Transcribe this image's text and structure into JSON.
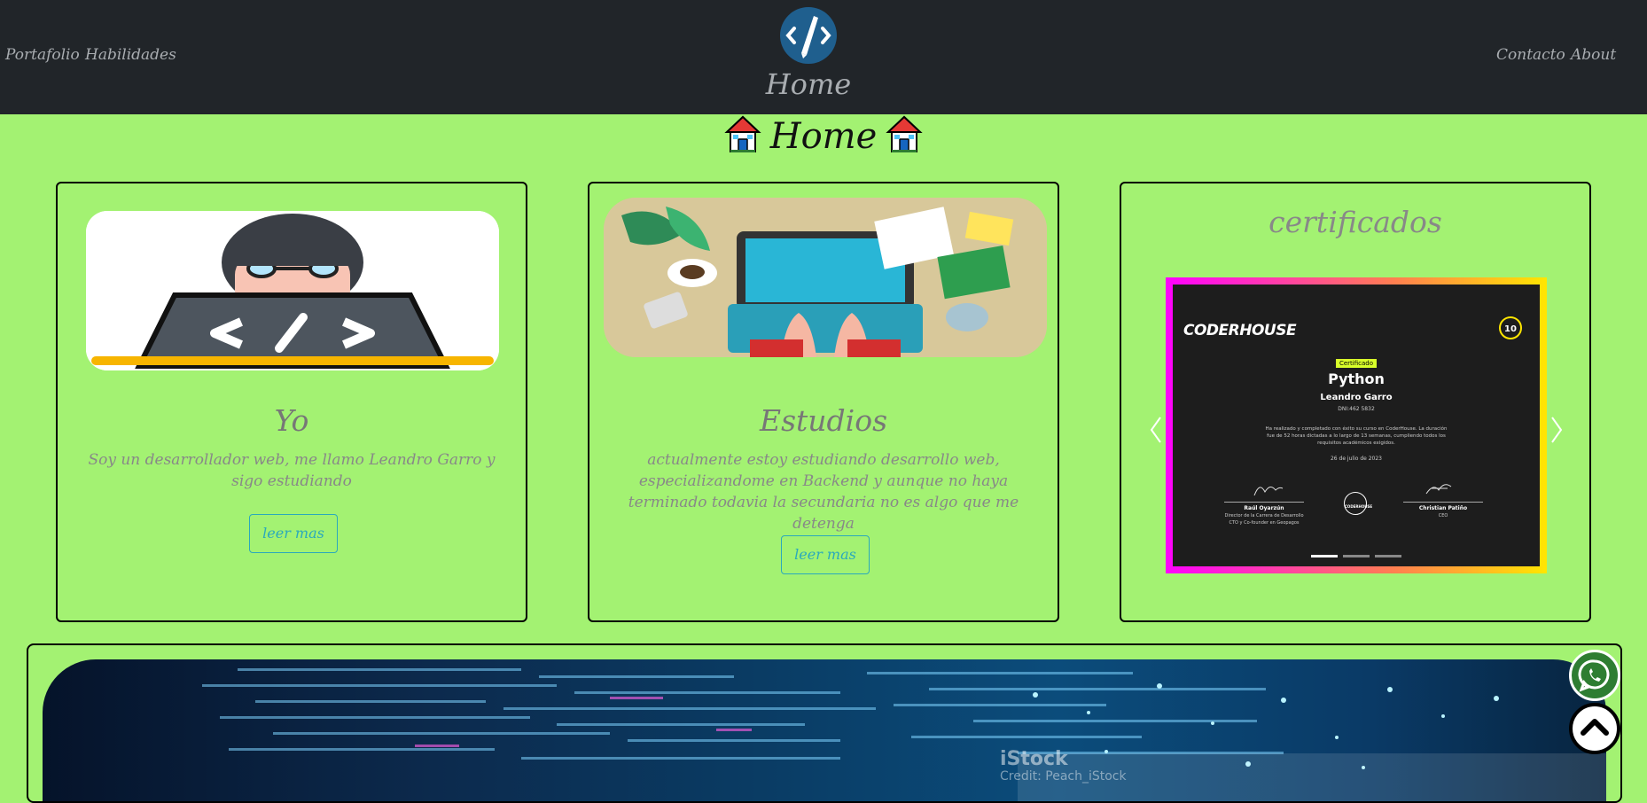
{
  "nav": {
    "left_links": [
      "Portafolio",
      "Habilidades"
    ],
    "right_links": [
      "Contacto",
      "About"
    ],
    "brand": "Home"
  },
  "page": {
    "title": "Home"
  },
  "cards": {
    "yo": {
      "title": "Yo",
      "text": "Soy un desarrollador web, me llamo Leandro Garro y sigo estudiando",
      "button": "leer mas"
    },
    "estudios": {
      "title": "Estudios",
      "text": "actualmente estoy estudiando desarrollo web, especializandome en Backend y aunque no haya terminado todavia la secundaria no es algo que me detenga",
      "button": "leer mas"
    },
    "certificados": {
      "title": "certificados",
      "carousel": {
        "slide_count": 3,
        "active_index": 0,
        "slide": {
          "brand": "CODERHOUSE",
          "badge": "Certificado",
          "course": "Python",
          "student": "Leandro Garro",
          "dni": "DNI:462 5832",
          "body": "Ha realizado y completado con éxito su curso en CoderHouse. La duración fue de 52 horas dictadas a lo largo de 13 semanas, cumpliendo todos los requisitos académicos exigidos.",
          "date": "26 de julio de 2023",
          "signer_left_name": "Raúl Oyarzún",
          "signer_left_role": "Director de la Carrera de Desarrollo",
          "signer_left_role2": "CTO y Co-founder en Geopagos",
          "center_seal": "CODERHOUSE",
          "signer_right_name": "Christian Patiño",
          "signer_right_role": "CEO",
          "top_badge": "10"
        }
      }
    }
  },
  "banner": {
    "watermark": "iStock",
    "credit": "Credit: Peach_iStock"
  },
  "colors": {
    "page_bg": "#a3f272",
    "navbar_bg": "#212529",
    "nav_text": "#a9adb1",
    "button_accent": "#2aa9bc",
    "whatsapp": "#25d366"
  },
  "icons": {
    "brand": "code-pen-icon",
    "title_left": "house-icon",
    "title_right": "house-icon",
    "whatsapp": "whatsapp-icon",
    "scroll_top": "chevron-up-icon"
  }
}
